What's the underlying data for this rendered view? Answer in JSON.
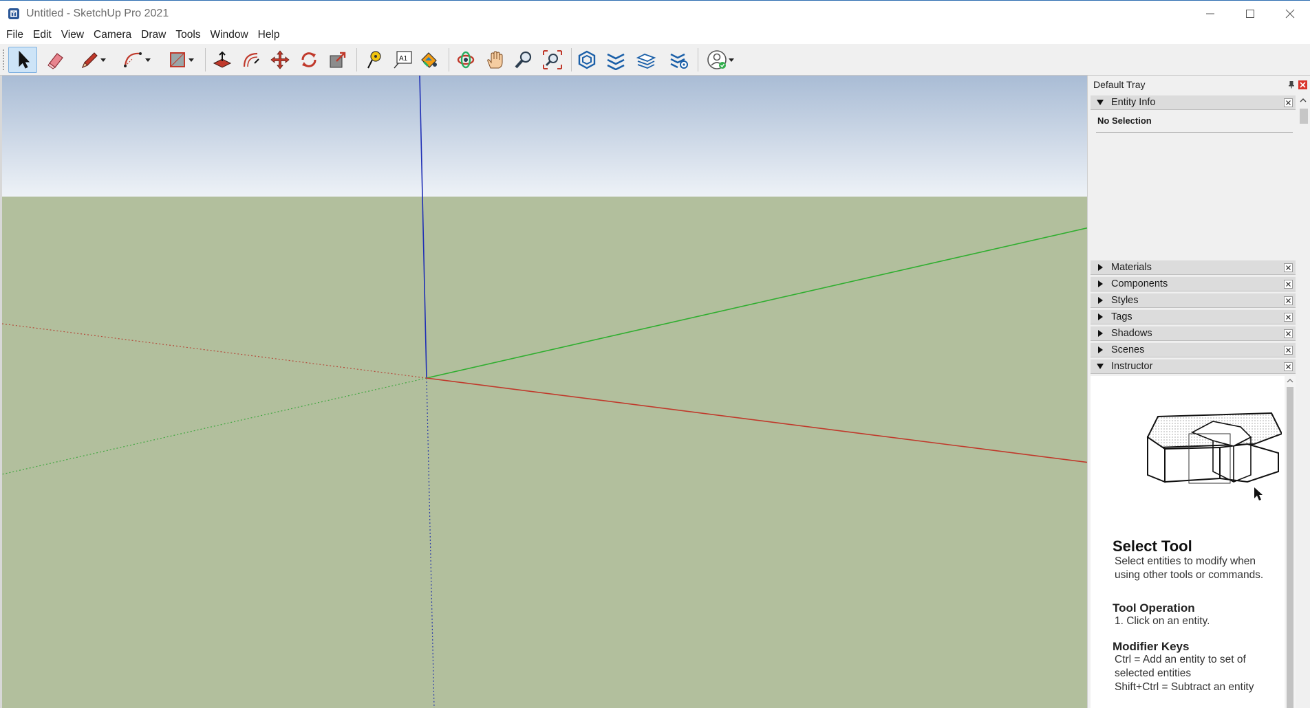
{
  "window": {
    "title": "Untitled - SketchUp Pro 2021"
  },
  "menu": {
    "items": [
      "File",
      "Edit",
      "View",
      "Camera",
      "Draw",
      "Tools",
      "Window",
      "Help"
    ]
  },
  "toolbar": {
    "tools": [
      {
        "name": "select",
        "icon": "arrow-select-icon",
        "active": true
      },
      {
        "name": "eraser",
        "icon": "eraser-icon"
      },
      {
        "name": "line",
        "icon": "pencil-icon",
        "dropdown": true
      },
      {
        "name": "arc",
        "icon": "arc-icon",
        "dropdown": true
      },
      {
        "name": "rectangle",
        "icon": "rectangle-icon",
        "dropdown": true
      },
      {
        "name": "push-pull",
        "icon": "push-pull-icon"
      },
      {
        "name": "offset",
        "icon": "offset-icon"
      },
      {
        "name": "move",
        "icon": "move-icon"
      },
      {
        "name": "rotate",
        "icon": "rotate-icon"
      },
      {
        "name": "scale",
        "icon": "scale-icon"
      },
      {
        "name": "tape-measure",
        "icon": "tape-measure-icon"
      },
      {
        "name": "text",
        "icon": "text-tool-icon",
        "label": "A1"
      },
      {
        "name": "paint-bucket",
        "icon": "paint-bucket-icon"
      },
      {
        "name": "orbit",
        "icon": "orbit-icon"
      },
      {
        "name": "pan",
        "icon": "pan-hand-icon"
      },
      {
        "name": "zoom",
        "icon": "zoom-icon"
      },
      {
        "name": "zoom-extents",
        "icon": "zoom-extents-icon"
      },
      {
        "name": "3d-warehouse",
        "icon": "warehouse-icon"
      },
      {
        "name": "extension-warehouse",
        "icon": "extension-warehouse-icon"
      },
      {
        "name": "layout",
        "icon": "layout-icon"
      },
      {
        "name": "extension-manager",
        "icon": "extension-manager-icon"
      },
      {
        "name": "account",
        "icon": "account-icon",
        "dropdown": true
      }
    ]
  },
  "colors": {
    "sky_top": "#a9bcd5",
    "sky_bottom": "#eef2f7",
    "ground": "#b2bf9d",
    "axis_red": "#c0392b",
    "axis_green": "#2fae2f",
    "axis_blue": "#1f2fb5",
    "tray_bg": "#f0f0f0",
    "panel_header": "#dcdcdc",
    "select_highlight": "#cde4f7"
  },
  "tray": {
    "title": "Default Tray",
    "entity_info": {
      "title": "Entity Info",
      "status": "No Selection"
    },
    "panels": [
      "Materials",
      "Components",
      "Styles",
      "Tags",
      "Shadows",
      "Scenes"
    ],
    "instructor": {
      "title": "Instructor",
      "tool_title": "Select Tool",
      "description": "Select entities to modify when using other tools or commands.",
      "operation_heading": "Tool Operation",
      "operation_step": "1. Click on an entity.",
      "modifier_heading": "Modifier Keys",
      "modifier_line1": "Ctrl = Add an entity to set of selected entities",
      "modifier_line2": "Shift+Ctrl = Subtract an entity"
    }
  }
}
